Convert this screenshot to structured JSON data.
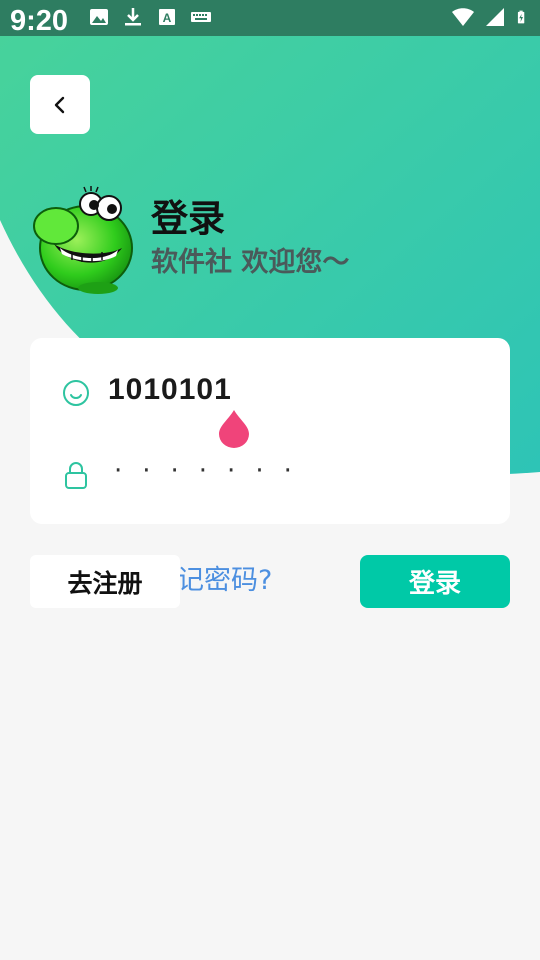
{
  "status_bar": {
    "time": "9:20",
    "left_icons": [
      "image-icon",
      "download-icon",
      "text-icon",
      "keyboard-icon"
    ],
    "right_icons": [
      "wifi-icon",
      "signal-icon",
      "battery-charging-icon"
    ]
  },
  "header": {
    "title": "登录",
    "subtitle": "软件社 欢迎您～"
  },
  "form": {
    "account_value": "1010101",
    "password_mask": "·······"
  },
  "actions": {
    "register_label": "去注册",
    "forgot_label": "忘记密码?",
    "login_label": "登录"
  },
  "colors": {
    "accent": "#00c9a7",
    "gradient_start": "#48d39a",
    "gradient_end": "#2ec4b6",
    "link": "#4c8fe0",
    "cursor_handle": "#f0447a"
  }
}
